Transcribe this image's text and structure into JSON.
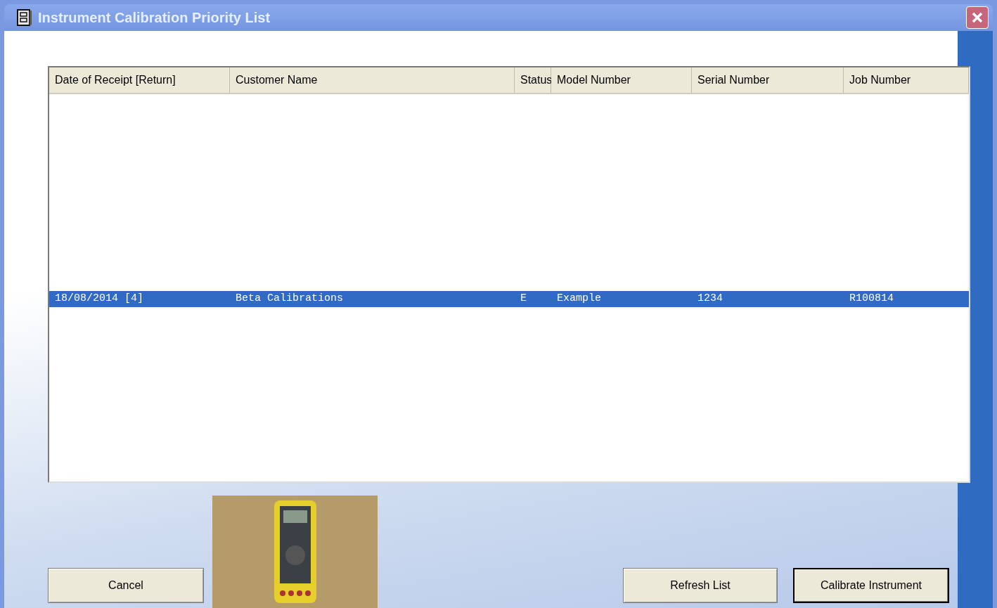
{
  "window": {
    "title": "Instrument Calibration Priority List"
  },
  "table": {
    "columns": [
      "Date of Receipt [Return]",
      "Customer Name",
      "Status",
      "Model Number",
      "Serial Number",
      "Job Number"
    ],
    "rows": [
      {
        "cells": [
          "18/08/2014 [4]",
          "Beta Calibrations",
          "E",
          "Example",
          "1234",
          "R100814"
        ],
        "selected": true
      }
    ]
  },
  "buttons": [
    {
      "label": "Cancel",
      "default": false
    },
    {
      "label": "Refresh List",
      "default": false
    },
    {
      "label": "Calibrate Instrument",
      "default": true
    }
  ]
}
